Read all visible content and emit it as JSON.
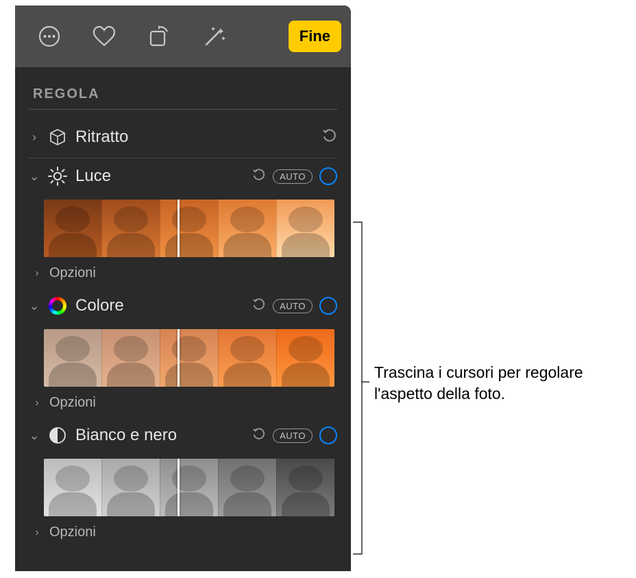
{
  "toolbar": {
    "done_label": "Fine"
  },
  "panel": {
    "title": "REGOLA",
    "sections": {
      "portrait": {
        "label": "Ritratto"
      },
      "light": {
        "label": "Luce",
        "auto": "AUTO",
        "options": "Opzioni"
      },
      "color": {
        "label": "Colore",
        "auto": "AUTO",
        "options": "Opzioni"
      },
      "bw": {
        "label": "Bianco e nero",
        "auto": "AUTO",
        "options": "Opzioni"
      }
    }
  },
  "callout": {
    "text": "Trascina i cursori per regolare l'aspetto della foto."
  }
}
